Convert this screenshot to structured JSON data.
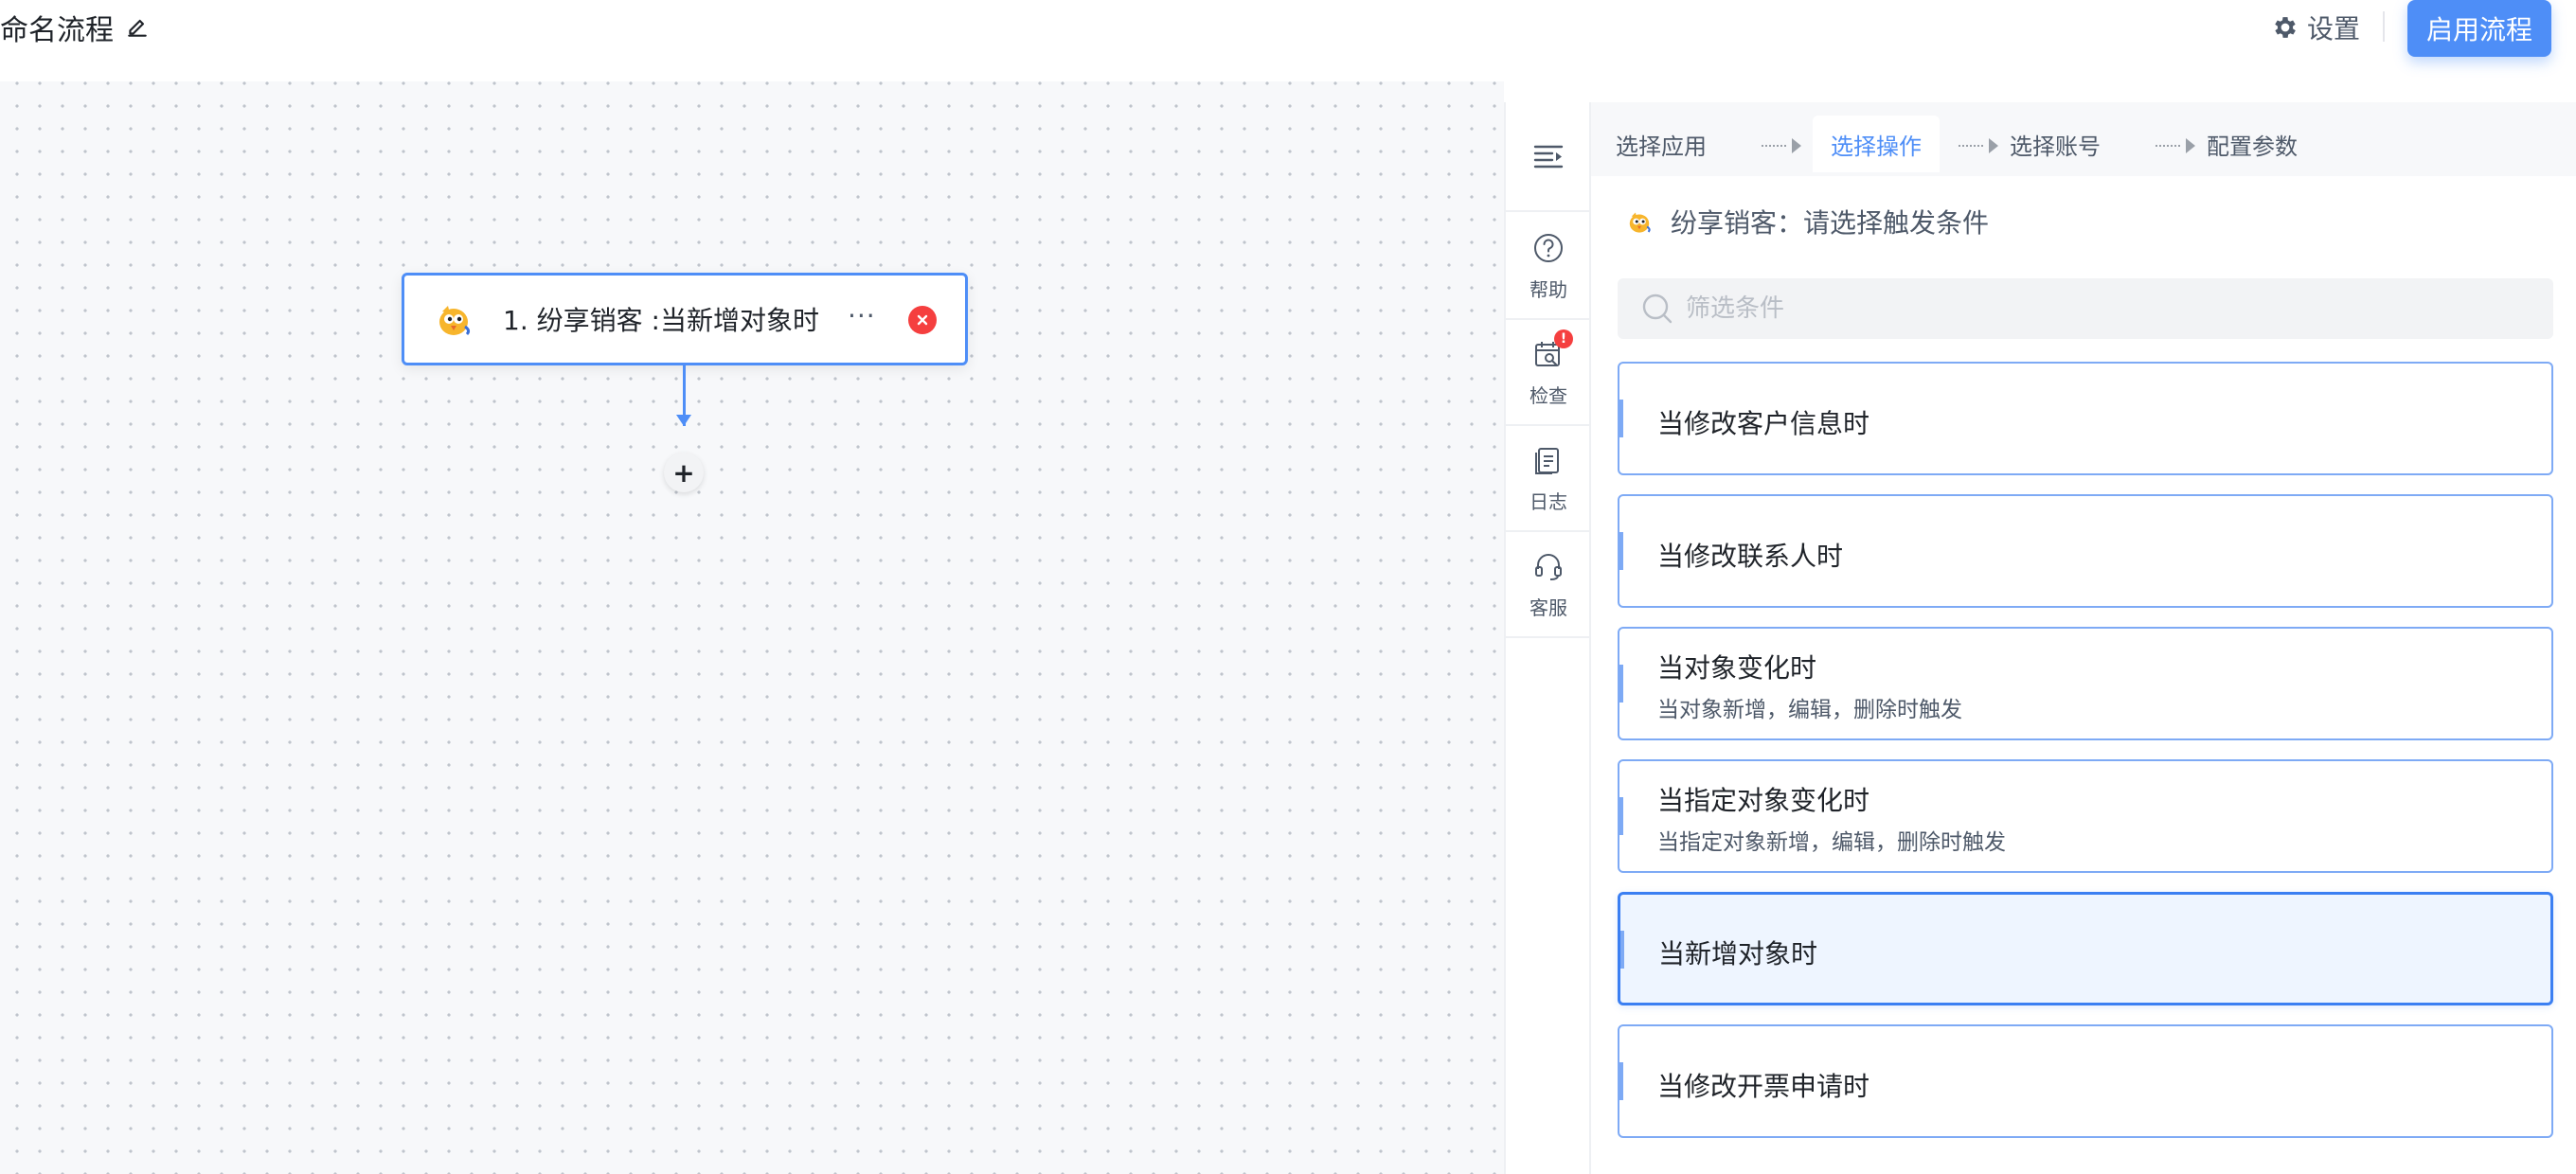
{
  "header": {
    "flow_title": "命名流程",
    "settings_label": "设置",
    "enable_label": "启用流程"
  },
  "canvas": {
    "node": {
      "label": "1. 纷享销客 :当新增对象时",
      "more_label": "···"
    },
    "add_label": "+"
  },
  "toolbar": {
    "items": [
      {
        "label": "帮助",
        "icon": "help-circle-icon"
      },
      {
        "label": "检查",
        "icon": "check-calendar-icon",
        "badge": "!"
      },
      {
        "label": "日志",
        "icon": "log-document-icon"
      },
      {
        "label": "客服",
        "icon": "headset-icon"
      }
    ]
  },
  "panel": {
    "steps": [
      {
        "label": "选择应用",
        "active": false
      },
      {
        "label": "选择操作",
        "active": true
      },
      {
        "label": "选择账号",
        "active": false
      },
      {
        "label": "配置参数",
        "active": false
      }
    ],
    "crumb": "纷享销客：请选择触发条件",
    "search_placeholder": "筛选条件",
    "options": [
      {
        "title": "当修改客户信息时",
        "desc": ""
      },
      {
        "title": "当修改联系人时",
        "desc": ""
      },
      {
        "title": "当对象变化时",
        "desc": "当对象新增，编辑，删除时触发"
      },
      {
        "title": "当指定对象变化时",
        "desc": "当指定对象新增，编辑，删除时触发"
      },
      {
        "title": "当新增对象时",
        "desc": "",
        "selected": true
      },
      {
        "title": "当修改开票申请时",
        "desc": ""
      }
    ]
  },
  "colors": {
    "primary": "#4e8ef7",
    "danger": "#f53f3f",
    "selected_bg": "#eef5ff"
  }
}
